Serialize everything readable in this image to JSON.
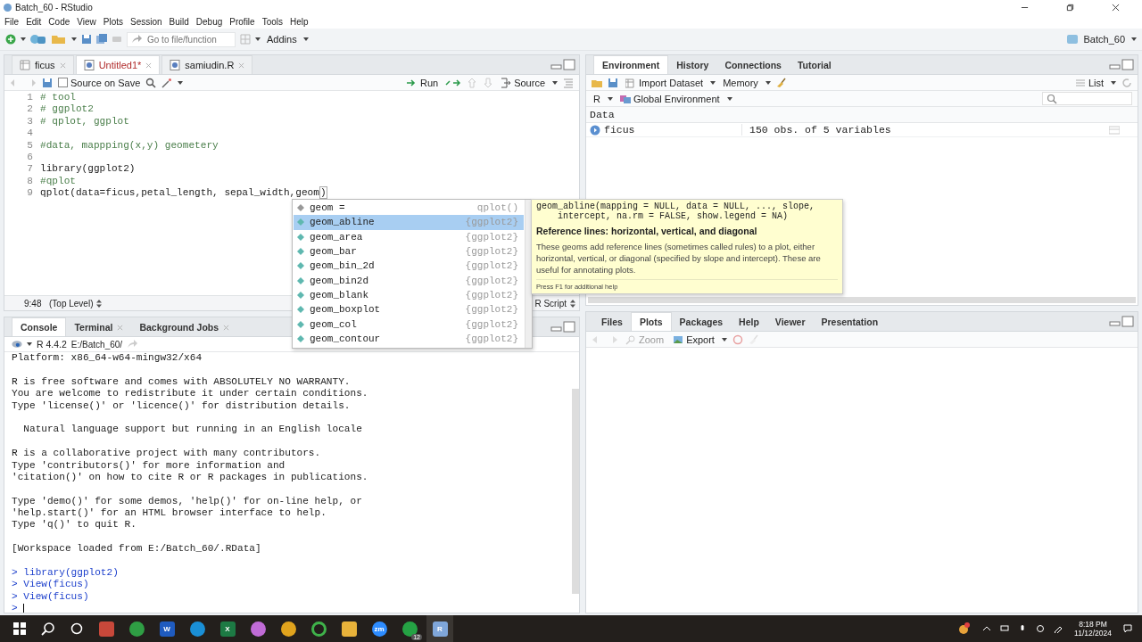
{
  "window": {
    "title": "Batch_60 - RStudio"
  },
  "menu": [
    "File",
    "Edit",
    "Code",
    "View",
    "Plots",
    "Session",
    "Build",
    "Debug",
    "Profile",
    "Tools",
    "Help"
  ],
  "toolbar": {
    "goto_placeholder": "Go to file/function",
    "addins": "Addins",
    "project": "Batch_60"
  },
  "editor": {
    "tabs": [
      {
        "label": "ficus",
        "kind": "data",
        "selected": false,
        "modified": false
      },
      {
        "label": "Untitled1*",
        "kind": "script",
        "selected": true,
        "modified": true
      },
      {
        "label": "samiudin.R",
        "kind": "script",
        "selected": false,
        "modified": false
      }
    ],
    "source_on_save": {
      "label": "Source on Save",
      "checked": false
    },
    "run": "Run",
    "source": "Source",
    "lines": [
      {
        "number": "1",
        "kind": "comment",
        "code": "# tool"
      },
      {
        "number": "2",
        "kind": "comment",
        "code": "# ggplot2"
      },
      {
        "number": "3",
        "kind": "comment",
        "code": "# qplot, ggplot"
      },
      {
        "number": "4",
        "kind": "blank"
      },
      {
        "number": "5",
        "kind": "comment",
        "code": "#data, mappping(x,y) geometery"
      },
      {
        "number": "6",
        "kind": "blank"
      },
      {
        "number": "7",
        "kind": "code",
        "code": "library(ggplot2)"
      },
      {
        "number": "8",
        "kind": "comment",
        "code": "#qplot"
      },
      {
        "number": "9",
        "kind": "code",
        "code": "qplot(data=ficus,petal_length, sepal_width,geom",
        "bracket": ")"
      }
    ],
    "status": {
      "position": "9:48",
      "scope": "(Top Level)",
      "filetype": "R Script"
    }
  },
  "autocomplete": {
    "items": [
      {
        "name": "geom =",
        "source": "qplot()",
        "kind": "argument",
        "selected": false
      },
      {
        "name": "geom_abline",
        "source": "{ggplot2}",
        "kind": "function",
        "selected": true
      },
      {
        "name": "geom_area",
        "source": "{ggplot2}",
        "kind": "function",
        "selected": false
      },
      {
        "name": "geom_bar",
        "source": "{ggplot2}",
        "kind": "function",
        "selected": false
      },
      {
        "name": "geom_bin_2d",
        "source": "{ggplot2}",
        "kind": "function",
        "selected": false
      },
      {
        "name": "geom_bin2d",
        "source": "{ggplot2}",
        "kind": "function",
        "selected": false
      },
      {
        "name": "geom_blank",
        "source": "{ggplot2}",
        "kind": "function",
        "selected": false
      },
      {
        "name": "geom_boxplot",
        "source": "{ggplot2}",
        "kind": "function",
        "selected": false
      },
      {
        "name": "geom_col",
        "source": "{ggplot2}",
        "kind": "function",
        "selected": false
      },
      {
        "name": "geom_contour",
        "source": "{ggplot2}",
        "kind": "function",
        "selected": false
      }
    ],
    "tooltip": {
      "signature": "geom_abline(mapping = NULL, data = NULL, ..., slope,\n    intercept, na.rm = FALSE, show.legend = NA)",
      "title": "Reference lines: horizontal, vertical, and diagonal",
      "description": "These geoms add reference lines (sometimes called rules) to a plot, either horizontal, vertical, or diagonal (specified by slope and intercept). These are useful for annotating plots.",
      "footer": "Press F1 for additional help"
    }
  },
  "console": {
    "tabs": [
      {
        "label": "Console",
        "selected": true,
        "closable": false
      },
      {
        "label": "Terminal",
        "selected": false,
        "closable": true
      },
      {
        "label": "Background Jobs",
        "selected": false,
        "closable": true
      }
    ],
    "version": "R 4.4.2",
    "path": "E:/Batch_60/",
    "lines": [
      {
        "kind": "output",
        "text": "Platform: x86_64-w64-mingw32/x64"
      },
      {
        "kind": "blank"
      },
      {
        "kind": "output",
        "text": "R is free software and comes with ABSOLUTELY NO WARRANTY."
      },
      {
        "kind": "output",
        "text": "You are welcome to redistribute it under certain conditions."
      },
      {
        "kind": "output",
        "text": "Type 'license()' or 'licence()' for distribution details."
      },
      {
        "kind": "blank"
      },
      {
        "kind": "output",
        "text": "  Natural language support but running in an English locale"
      },
      {
        "kind": "blank"
      },
      {
        "kind": "output",
        "text": "R is a collaborative project with many contributors."
      },
      {
        "kind": "output",
        "text": "Type 'contributors()' for more information and"
      },
      {
        "kind": "output",
        "text": "'citation()' on how to cite R or R packages in publications."
      },
      {
        "kind": "blank"
      },
      {
        "kind": "output",
        "text": "Type 'demo()' for some demos, 'help()' for on-line help, or"
      },
      {
        "kind": "output",
        "text": "'help.start()' for an HTML browser interface to help."
      },
      {
        "kind": "output",
        "text": "Type 'q()' to quit R."
      },
      {
        "kind": "blank"
      },
      {
        "kind": "output",
        "text": "[Workspace loaded from E:/Batch_60/.RData]"
      },
      {
        "kind": "blank"
      },
      {
        "kind": "command",
        "prompt": ">",
        "text": "library(ggplot2)"
      },
      {
        "kind": "command",
        "prompt": ">",
        "text": "View(ficus)"
      },
      {
        "kind": "command",
        "prompt": ">",
        "text": "View(ficus)"
      },
      {
        "kind": "prompt",
        "prompt": ">"
      }
    ]
  },
  "environment": {
    "tabs": [
      {
        "label": "Environment",
        "selected": true
      },
      {
        "label": "History",
        "selected": false
      },
      {
        "label": "Connections",
        "selected": false
      },
      {
        "label": "Tutorial",
        "selected": false
      }
    ],
    "import": "Import Dataset",
    "memory": "Memory",
    "view": "List",
    "language": "R",
    "scope": "Global Environment",
    "section": "Data",
    "rows": [
      {
        "name": "ficus",
        "value": "150 obs. of 5 variables"
      }
    ]
  },
  "files": {
    "tabs": [
      {
        "label": "Files",
        "selected": false
      },
      {
        "label": "Plots",
        "selected": true
      },
      {
        "label": "Packages",
        "selected": false
      },
      {
        "label": "Help",
        "selected": false
      },
      {
        "label": "Viewer",
        "selected": false
      },
      {
        "label": "Presentation",
        "selected": false
      }
    ],
    "zoom": {
      "label": "Zoom",
      "disabled": true
    },
    "export": "Export"
  },
  "taskbar": {
    "apps": [
      {
        "kind": "tile",
        "color": "#c8483a",
        "selected": false
      },
      {
        "kind": "round",
        "color": "#2f9e44",
        "selected": false
      },
      {
        "kind": "tile",
        "color": "#1f5bbf",
        "glyph": "W",
        "selected": false
      },
      {
        "kind": "round",
        "color": "#1a8fd6",
        "selected": false
      },
      {
        "kind": "tile",
        "color": "#1d7a44",
        "glyph": "X",
        "selected": false
      },
      {
        "kind": "round",
        "color": "#c06bd6",
        "selected": false
      },
      {
        "kind": "round",
        "color": "#e0a31d",
        "selected": false
      },
      {
        "kind": "ring",
        "color": "#3fb24a",
        "selected": false
      },
      {
        "kind": "tile",
        "color": "#e8b23a",
        "selected": false
      },
      {
        "kind": "round",
        "color": "#2d8cff",
        "glyph": "zm",
        "selected": false
      },
      {
        "kind": "round",
        "color": "#25a244",
        "badge": "12",
        "selected": false
      },
      {
        "kind": "tile",
        "color": "#7fa6d9",
        "glyph": "R",
        "selected": true
      }
    ],
    "time": "8:18 PM",
    "date": "11/12/2024"
  }
}
